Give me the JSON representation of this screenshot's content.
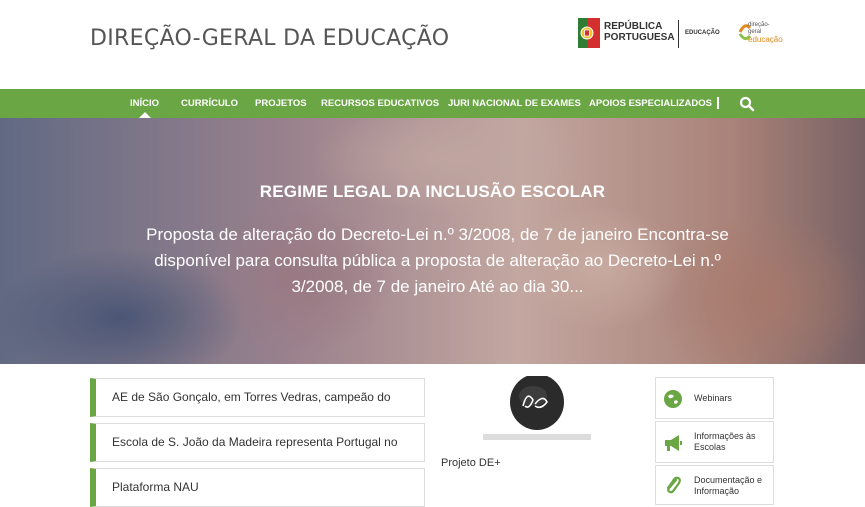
{
  "header": {
    "site_title": "DIREÇÃO-GERAL DA EDUCAÇÃO",
    "gov_logo_line1": "REPÚBLICA",
    "gov_logo_line2": "PORTUGUESA",
    "gov_logo_sub": "EDUCAÇÃO",
    "dge_logo_line1": "direção-geral",
    "dge_logo_line2": "educação"
  },
  "nav": {
    "items": [
      {
        "label": "INÍCIO"
      },
      {
        "label": "CURRÍCULO"
      },
      {
        "label": "PROJETOS"
      },
      {
        "label": "RECURSOS EDUCATIVOS"
      },
      {
        "label": "JURI NACIONAL DE EXAMES"
      },
      {
        "label": "APOIOS ESPECIALIZADOS"
      }
    ],
    "active_index": 0
  },
  "hero": {
    "title": "REGIME LEGAL DA INCLUSÃO ESCOLAR",
    "text": "Proposta de alteração do Decreto-Lei n.º 3/2008, de 7 de janeiro Encontra-se disponível para consulta pública a proposta de alteração ao Decreto-Lei n.º 3/2008, de 7 de janeiro Até ao dia 30..."
  },
  "news": [
    {
      "title": "AE de São Gonçalo, em Torres Vedras, campeão do"
    },
    {
      "title": "Escola de S. João da Madeira representa Portugal no"
    },
    {
      "title": "Plataforma NAU"
    }
  ],
  "project": {
    "label": "Projeto DE+"
  },
  "sidebar": [
    {
      "label": "Webinars",
      "icon": "globe-icon"
    },
    {
      "label": "Informações às Escolas",
      "icon": "megaphone-icon"
    },
    {
      "label": "Documentação e Informação",
      "icon": "paperclip-icon"
    }
  ],
  "colors": {
    "accent": "#6aa644",
    "text": "#333333"
  }
}
